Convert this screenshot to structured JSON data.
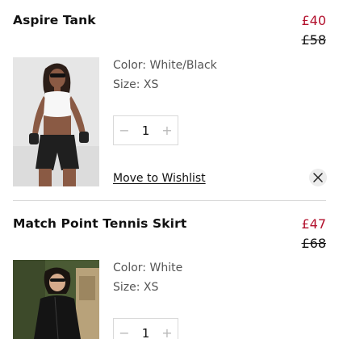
{
  "cart": {
    "items": [
      {
        "name": "Aspire Tank",
        "sale_price": "£40",
        "original_price": "£58",
        "color": "Color: White/Black",
        "size": "Size: XS",
        "quantity": "1",
        "wishlist_label": "Move to Wishlist"
      },
      {
        "name": "Match Point Tennis Skirt",
        "sale_price": "£47",
        "original_price": "£68",
        "color": "Color: White",
        "size": "Size: XS",
        "quantity": "1"
      }
    ],
    "stepper": {
      "decrement_symbol": "−",
      "increment_symbol": "+"
    },
    "icons": {
      "remove": "close-icon"
    },
    "colors": {
      "sale_price": "#b3122e",
      "text": "#111111",
      "muted": "#555555",
      "divider": "#d9d9d9"
    }
  }
}
